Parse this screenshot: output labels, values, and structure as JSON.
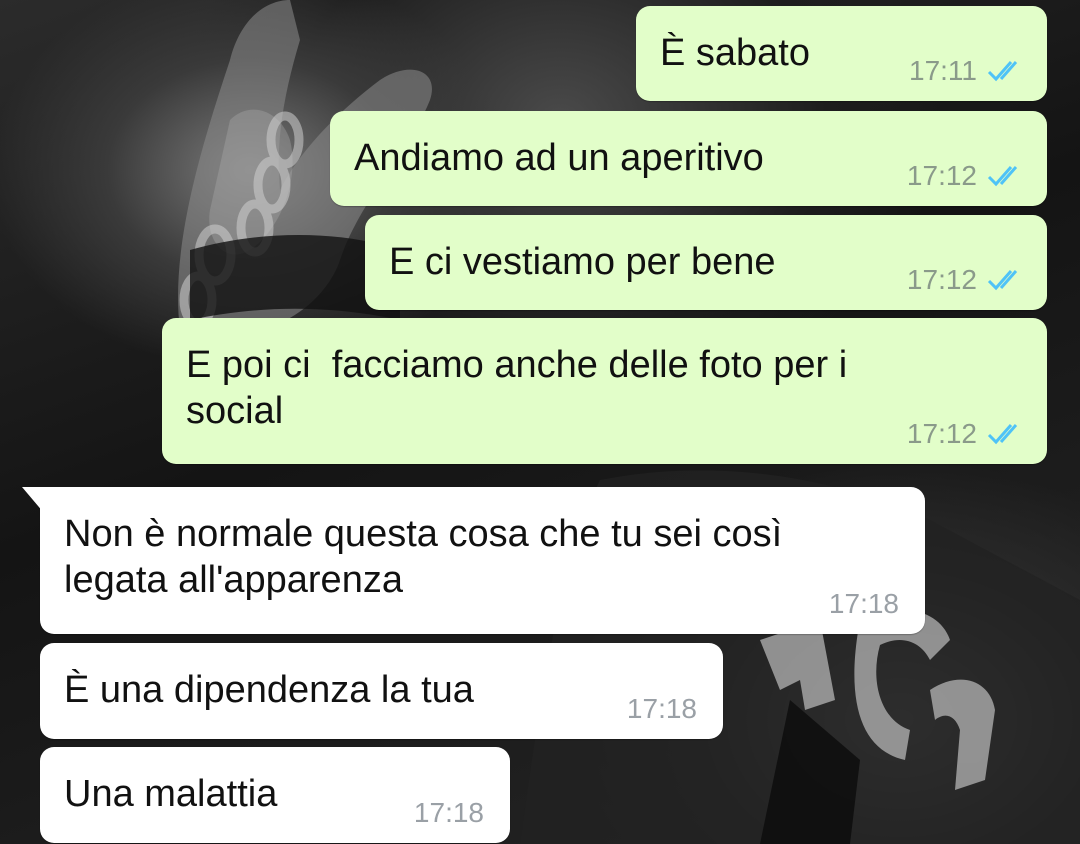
{
  "messages": [
    {
      "direction": "outgoing",
      "text": "È sabato",
      "time": "17:11",
      "status": "read"
    },
    {
      "direction": "outgoing",
      "text": "Andiamo ad un aperitivo",
      "time": "17:12",
      "status": "read"
    },
    {
      "direction": "outgoing",
      "text": "E ci vestiamo per bene",
      "time": "17:12",
      "status": "read"
    },
    {
      "direction": "outgoing",
      "text": "E poi ci  facciamo anche delle foto per i\nsocial",
      "time": "17:12",
      "status": "read"
    },
    {
      "direction": "incoming",
      "text": "Non è normale questa cosa che tu sei così\nlegata all'apparenza",
      "time": "17:18"
    },
    {
      "direction": "incoming",
      "text": "È una dipendenza la tua",
      "time": "17:18"
    },
    {
      "direction": "incoming",
      "text": "Una malattia",
      "time": "17:18"
    }
  ],
  "colors": {
    "outgoing_bubble": "#e2fec9",
    "incoming_bubble": "#ffffff",
    "read_ticks": "#4fc3f7"
  },
  "icons": {
    "read_status": "double-check-icon"
  }
}
